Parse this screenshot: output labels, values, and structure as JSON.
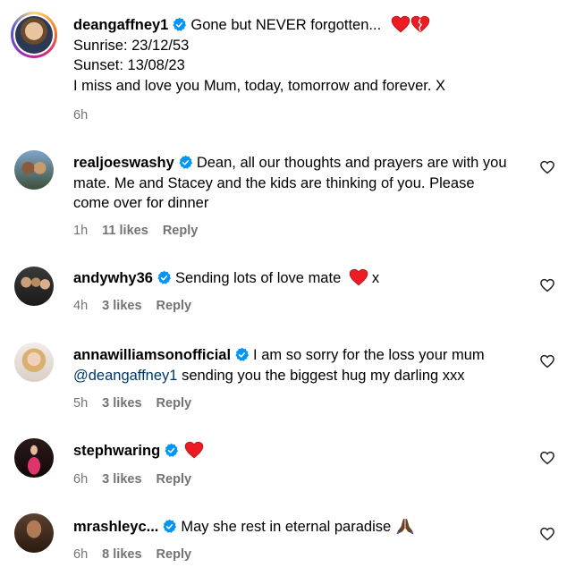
{
  "post": {
    "username": "deangaffney1",
    "caption_line1": "Gone but NEVER forgotten...",
    "line2": "Sunrise: 23/12/53",
    "line3": "Sunset: 13/08/23",
    "line4": "I miss and love you Mum, today, tomorrow and forever. X",
    "time": "6h"
  },
  "comments": [
    {
      "username": "realjoeswashy",
      "text": "Dean, all our thoughts and prayers are with you mate. Me and Stacey and the kids are thinking of you. Please come over for dinner",
      "time": "1h",
      "likes": "11 likes",
      "reply": "Reply"
    },
    {
      "username": "andywhy36",
      "text": "Sending lots of love mate",
      "suffix": "x",
      "time": "4h",
      "likes": "3 likes",
      "reply": "Reply"
    },
    {
      "username": "annawilliamsonofficial",
      "text": "I am so sorry for the loss your mum",
      "mention": "@deangaffney1",
      "text2": "sending you the biggest hug my darling xxx",
      "time": "5h",
      "likes": "3 likes",
      "reply": "Reply"
    },
    {
      "username": "stephwaring",
      "time": "6h",
      "likes": "3 likes",
      "reply": "Reply"
    },
    {
      "username": "mrashleyc...",
      "text": "May she rest in eternal paradise",
      "time": "6h",
      "likes": "8 likes",
      "reply": "Reply"
    }
  ],
  "colors": {
    "verified": "#0095f6",
    "heart": "#ed1c24",
    "meta": "#737373",
    "mention": "#00376b"
  },
  "icons": {
    "verified": "verified-badge-icon",
    "heart_emoji": "red-heart-emoji",
    "broken_heart_emoji": "broken-heart-emoji",
    "like": "heart-outline-icon",
    "pray": "folded-hands-emoji"
  }
}
